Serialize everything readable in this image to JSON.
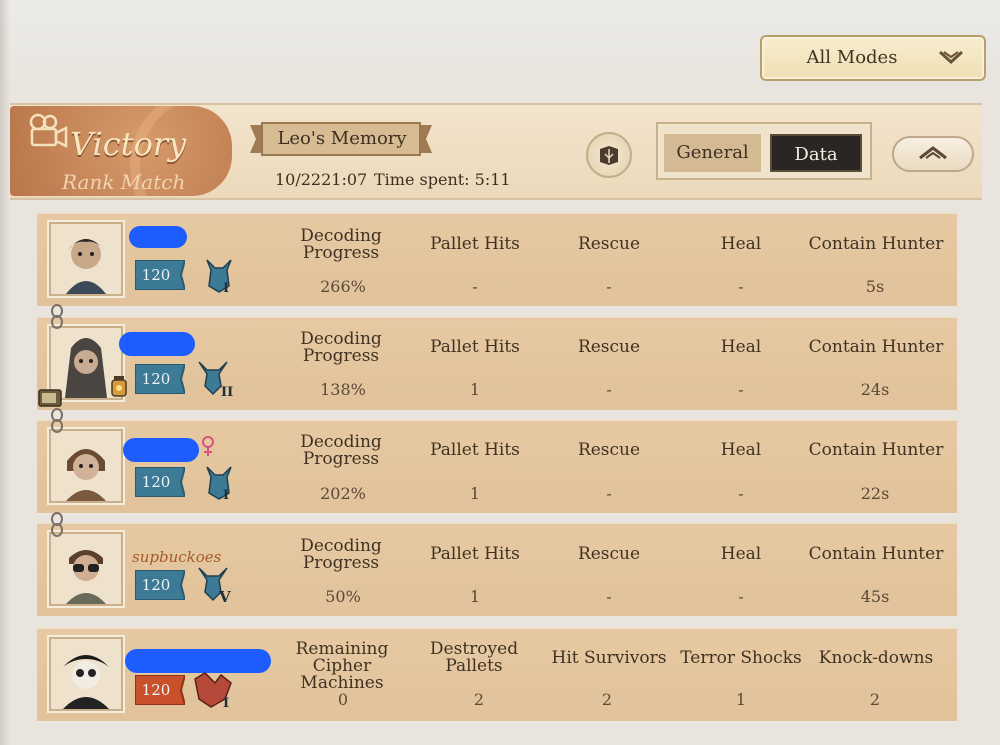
{
  "header": {
    "mode_dropdown": "All Modes",
    "result": "Victory",
    "match_type": "Rank Match",
    "map_name": "Leo's Memory",
    "date": "10/2221:07",
    "time_spent": "Time spent: 5:11",
    "tabs": [
      "General",
      "Data"
    ],
    "active_tab": "Data"
  },
  "survivor_columns": [
    "Decoding Progress",
    "Pallet Hits",
    "Rescue",
    "Heal",
    "Contain Hunter"
  ],
  "hunter_columns": [
    "Remaining Cipher Machines",
    "Destroyed Pallets",
    "Hit Survivors",
    "Terror Shocks",
    "Knock-downs"
  ],
  "players": [
    {
      "name": "",
      "level": "120",
      "rank_mark": "I",
      "values": [
        "266%",
        "-",
        "-",
        "-",
        "5s"
      ],
      "accent": "#3c7a95"
    },
    {
      "name": "",
      "level": "120",
      "rank_mark": "II",
      "values": [
        "138%",
        "1",
        "-",
        "-",
        "24s"
      ],
      "accent": "#3c7a95"
    },
    {
      "name": "",
      "level": "120",
      "rank_mark": "I",
      "values": [
        "202%",
        "1",
        "-",
        "-",
        "22s"
      ],
      "accent": "#3c7a95"
    },
    {
      "name": "supbuckoes",
      "level": "120",
      "rank_mark": "V",
      "values": [
        "50%",
        "1",
        "-",
        "-",
        "45s"
      ],
      "accent": "#3c7a95"
    },
    {
      "name": "",
      "level": "120",
      "rank_mark": "I",
      "values": [
        "0",
        "2",
        "2",
        "1",
        "2"
      ],
      "accent": "#c8502a"
    }
  ]
}
